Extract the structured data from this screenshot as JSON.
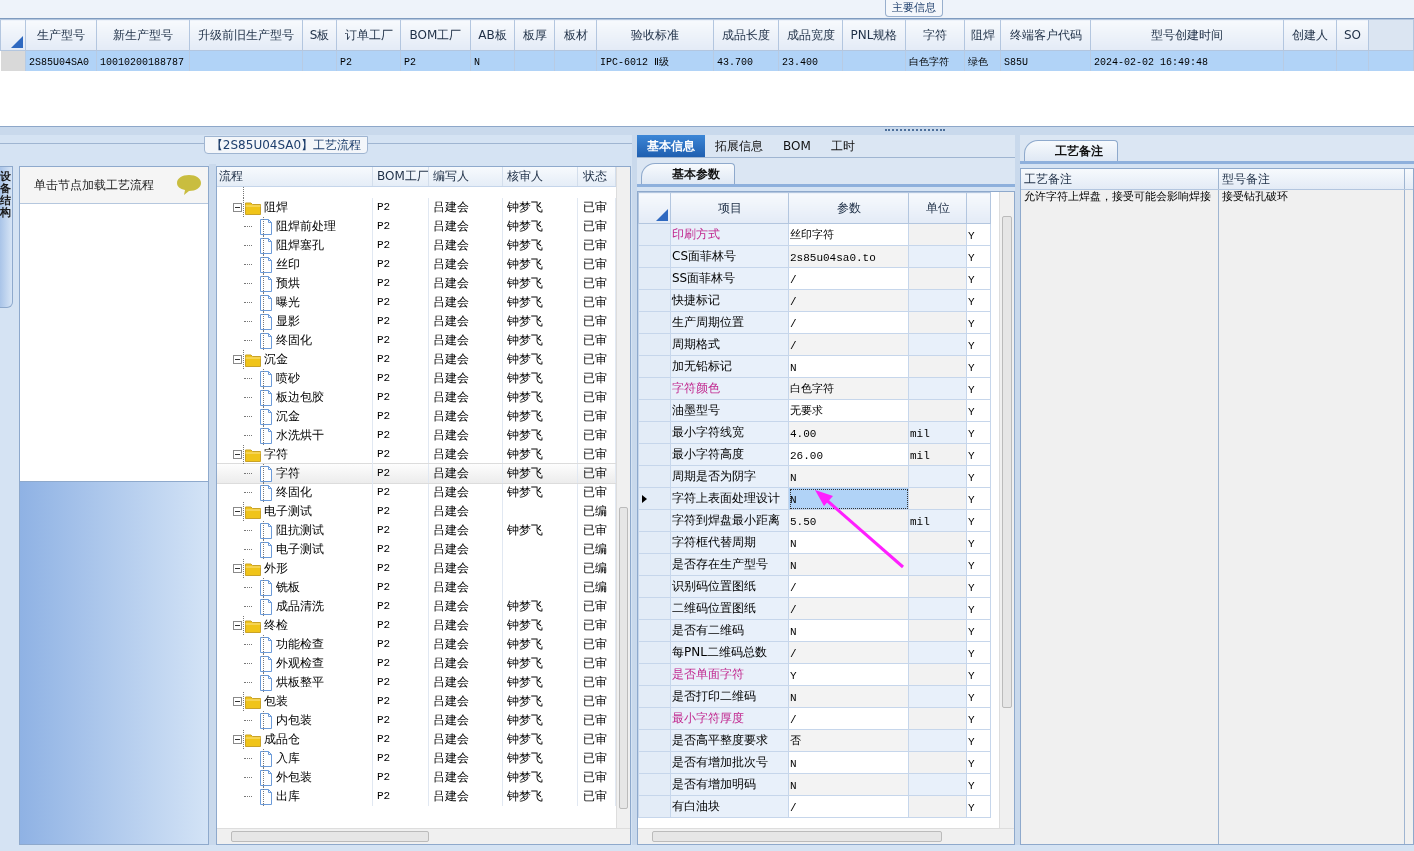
{
  "top_panel": {
    "group_title": "主要信息",
    "columns": [
      "生产型号",
      "新生产型号",
      "升级前旧生产型号",
      "S板",
      "订单工厂",
      "BOM工厂",
      "AB板",
      "板厚",
      "板材",
      "验收标准",
      "成品长度",
      "成品宽度",
      "PNL规格",
      "字符",
      "阻焊",
      "终端客户代码",
      "型号创建时间",
      "创建人",
      "SO"
    ],
    "rows": [
      {
        "selected": true,
        "cells": [
          "2S85U04SA0",
          "10010200188787",
          null,
          null,
          "P2",
          "P2",
          "N",
          null,
          null,
          "IPC-6012 Ⅱ级",
          "43.700",
          "23.400",
          null,
          "白色字符",
          "绿色",
          "S85U",
          "2024-02-02 16:49:48",
          null,
          null
        ]
      }
    ]
  },
  "process_panel": {
    "title": "【2S85U04SA0】工艺流程",
    "side_tab": "设备结构",
    "hint": "单击节点加载工艺流程",
    "tree_columns": [
      "流程",
      "BOM工厂",
      "编写人",
      "核审人",
      "状态"
    ],
    "tree": [
      {
        "name": "阻焊",
        "bom": "P2",
        "writer": "吕建会",
        "reviewer": "钟梦飞",
        "status": "已审",
        "expanded": true,
        "selected": false,
        "children": [
          {
            "name": "阻焊前处理",
            "bom": "P2",
            "writer": "吕建会",
            "reviewer": "钟梦飞",
            "status": "已审",
            "selected": false
          },
          {
            "name": "阻焊塞孔",
            "bom": "P2",
            "writer": "吕建会",
            "reviewer": "钟梦飞",
            "status": "已审",
            "selected": false
          },
          {
            "name": "丝印",
            "bom": "P2",
            "writer": "吕建会",
            "reviewer": "钟梦飞",
            "status": "已审",
            "selected": false
          },
          {
            "name": "预烘",
            "bom": "P2",
            "writer": "吕建会",
            "reviewer": "钟梦飞",
            "status": "已审",
            "selected": false
          },
          {
            "name": "曝光",
            "bom": "P2",
            "writer": "吕建会",
            "reviewer": "钟梦飞",
            "status": "已审",
            "selected": false
          },
          {
            "name": "显影",
            "bom": "P2",
            "writer": "吕建会",
            "reviewer": "钟梦飞",
            "status": "已审",
            "selected": false
          },
          {
            "name": "终固化",
            "bom": "P2",
            "writer": "吕建会",
            "reviewer": "钟梦飞",
            "status": "已审",
            "selected": false
          }
        ]
      },
      {
        "name": "沉金",
        "bom": "P2",
        "writer": "吕建会",
        "reviewer": "钟梦飞",
        "status": "已审",
        "expanded": true,
        "selected": false,
        "children": [
          {
            "name": "喷砂",
            "bom": "P2",
            "writer": "吕建会",
            "reviewer": "钟梦飞",
            "status": "已审",
            "selected": false
          },
          {
            "name": "板边包胶",
            "bom": "P2",
            "writer": "吕建会",
            "reviewer": "钟梦飞",
            "status": "已审",
            "selected": false
          },
          {
            "name": "沉金",
            "bom": "P2",
            "writer": "吕建会",
            "reviewer": "钟梦飞",
            "status": "已审",
            "selected": false
          },
          {
            "name": "水洗烘干",
            "bom": "P2",
            "writer": "吕建会",
            "reviewer": "钟梦飞",
            "status": "已审",
            "selected": false
          }
        ]
      },
      {
        "name": "字符",
        "bom": "P2",
        "writer": "吕建会",
        "reviewer": "钟梦飞",
        "status": "已审",
        "expanded": true,
        "selected": false,
        "children": [
          {
            "name": "字符",
            "bom": "P2",
            "writer": "吕建会",
            "reviewer": "钟梦飞",
            "status": "已审",
            "selected": true
          },
          {
            "name": "终固化",
            "bom": "P2",
            "writer": "吕建会",
            "reviewer": "钟梦飞",
            "status": "已审",
            "selected": false
          }
        ]
      },
      {
        "name": "电子测试",
        "bom": "P2",
        "writer": "吕建会",
        "status": "已编",
        "expanded": true,
        "selected": false,
        "children": [
          {
            "name": "阻抗测试",
            "bom": "P2",
            "writer": "吕建会",
            "reviewer": "钟梦飞",
            "status": "已审",
            "selected": false
          },
          {
            "name": "电子测试",
            "bom": "P2",
            "writer": "吕建会",
            "status": "已编",
            "selected": false
          }
        ]
      },
      {
        "name": "外形",
        "bom": "P2",
        "writer": "吕建会",
        "status": "已编",
        "expanded": true,
        "selected": false,
        "children": [
          {
            "name": "铣板",
            "bom": "P2",
            "writer": "吕建会",
            "status": "已编",
            "selected": false
          },
          {
            "name": "成品清洗",
            "bom": "P2",
            "writer": "吕建会",
            "reviewer": "钟梦飞",
            "status": "已审",
            "selected": false
          }
        ]
      },
      {
        "name": "终检",
        "bom": "P2",
        "writer": "吕建会",
        "reviewer": "钟梦飞",
        "status": "已审",
        "expanded": true,
        "selected": false,
        "children": [
          {
            "name": "功能检查",
            "bom": "P2",
            "writer": "吕建会",
            "reviewer": "钟梦飞",
            "status": "已审",
            "selected": false
          },
          {
            "name": "外观检查",
            "bom": "P2",
            "writer": "吕建会",
            "reviewer": "钟梦飞",
            "status": "已审",
            "selected": false
          },
          {
            "name": "烘板整平",
            "bom": "P2",
            "writer": "吕建会",
            "reviewer": "钟梦飞",
            "status": "已审",
            "selected": false
          }
        ]
      },
      {
        "name": "包装",
        "bom": "P2",
        "writer": "吕建会",
        "reviewer": "钟梦飞",
        "status": "已审",
        "expanded": true,
        "selected": false,
        "children": [
          {
            "name": "内包装",
            "bom": "P2",
            "writer": "吕建会",
            "reviewer": "钟梦飞",
            "status": "已审",
            "selected": false
          }
        ]
      },
      {
        "name": "成品仓",
        "bom": "P2",
        "writer": "吕建会",
        "reviewer": "钟梦飞",
        "status": "已审",
        "expanded": true,
        "selected": false,
        "children": [
          {
            "name": "入库",
            "bom": "P2",
            "writer": "吕建会",
            "reviewer": "钟梦飞",
            "status": "已审",
            "selected": false
          },
          {
            "name": "外包装",
            "bom": "P2",
            "writer": "吕建会",
            "reviewer": "钟梦飞",
            "status": "已审",
            "selected": false
          },
          {
            "name": "出库",
            "bom": "P2",
            "writer": "吕建会",
            "reviewer": "钟梦飞",
            "status": "已审",
            "selected": false
          }
        ]
      }
    ]
  },
  "info_panel": {
    "tabs": [
      {
        "label": "基本信息",
        "selected": true
      },
      {
        "label": "拓展信息",
        "selected": false
      },
      {
        "label": "BOM",
        "selected": false
      },
      {
        "label": "工时",
        "selected": false
      }
    ],
    "subtab": "基本参数",
    "columns": [
      "项目",
      "参数",
      "单位"
    ],
    "rows": [
      {
        "item": "印刷方式",
        "value": "丝印字符",
        "flag": "Y",
        "emphasis": true,
        "selected": false
      },
      {
        "item": "CS面菲林号",
        "value": "2s85u04sa0.to",
        "flag": "Y",
        "emphasis": false,
        "selected": false
      },
      {
        "item": "SS面菲林号",
        "value": "/",
        "flag": "Y",
        "emphasis": false,
        "selected": false
      },
      {
        "item": "快捷标记",
        "value": "/",
        "flag": "Y",
        "emphasis": false,
        "selected": false
      },
      {
        "item": "生产周期位置",
        "value": "/",
        "flag": "Y",
        "emphasis": false,
        "selected": false
      },
      {
        "item": "周期格式",
        "value": "/",
        "flag": "Y",
        "emphasis": false,
        "selected": false
      },
      {
        "item": "加无铅标记",
        "value": "N",
        "flag": "Y",
        "emphasis": false,
        "selected": false
      },
      {
        "item": "字符颜色",
        "value": "白色字符",
        "flag": "Y",
        "emphasis": true,
        "selected": false
      },
      {
        "item": "油墨型号",
        "value": "无要求",
        "flag": "Y",
        "emphasis": false,
        "selected": false
      },
      {
        "item": "最小字符线宽",
        "value": "4.00",
        "unit": "mil",
        "flag": "Y",
        "emphasis": false,
        "selected": false
      },
      {
        "item": "最小字符高度",
        "value": "26.00",
        "unit": "mil",
        "flag": "Y",
        "emphasis": false,
        "selected": false
      },
      {
        "item": "周期是否为阴字",
        "value": "N",
        "flag": "Y",
        "emphasis": false,
        "selected": false
      },
      {
        "item": "字符上表面处理设计",
        "value": "N",
        "flag": "Y",
        "emphasis": false,
        "selected": true
      },
      {
        "item": "字符到焊盘最小距离",
        "value": "5.50",
        "unit": "mil",
        "flag": "Y",
        "emphasis": false,
        "selected": false
      },
      {
        "item": "字符框代替周期",
        "value": "N",
        "flag": "Y",
        "emphasis": false,
        "selected": false
      },
      {
        "item": "是否存在生产型号",
        "value": "N",
        "flag": "Y",
        "emphasis": false,
        "selected": false
      },
      {
        "item": "识别码位置图纸",
        "value": "/",
        "flag": "Y",
        "emphasis": false,
        "selected": false
      },
      {
        "item": "二维码位置图纸",
        "value": "/",
        "flag": "Y",
        "emphasis": false,
        "selected": false
      },
      {
        "item": "是否有二维码",
        "value": "N",
        "flag": "Y",
        "emphasis": false,
        "selected": false
      },
      {
        "item": "每PNL二维码总数",
        "value": "/",
        "flag": "Y",
        "emphasis": false,
        "selected": false
      },
      {
        "item": "是否单面字符",
        "value": "Y",
        "flag": "Y",
        "emphasis": true,
        "selected": false
      },
      {
        "item": "是否打印二维码",
        "value": "N",
        "flag": "Y",
        "emphasis": false,
        "selected": false
      },
      {
        "item": "最小字符厚度",
        "value": "/",
        "flag": "Y",
        "emphasis": true,
        "selected": false
      },
      {
        "item": "是否高平整度要求",
        "value": "否",
        "flag": "Y",
        "emphasis": false,
        "selected": false
      },
      {
        "item": "是否有增加批次号",
        "value": "N",
        "flag": "Y",
        "emphasis": false,
        "selected": false
      },
      {
        "item": "是否有增加明码",
        "value": "N",
        "flag": "Y",
        "emphasis": false,
        "selected": false
      },
      {
        "item": "有白油块",
        "value": "/",
        "flag": "Y",
        "emphasis": false,
        "selected": false
      }
    ]
  },
  "remarks_panel": {
    "tab": "工艺备注",
    "columns": [
      "工艺备注",
      "型号备注"
    ],
    "rows": [
      {
        "process_note": "允许字符上焊盘，接受可能会影响焊接",
        "model_note": "接受钻孔破环"
      }
    ]
  }
}
